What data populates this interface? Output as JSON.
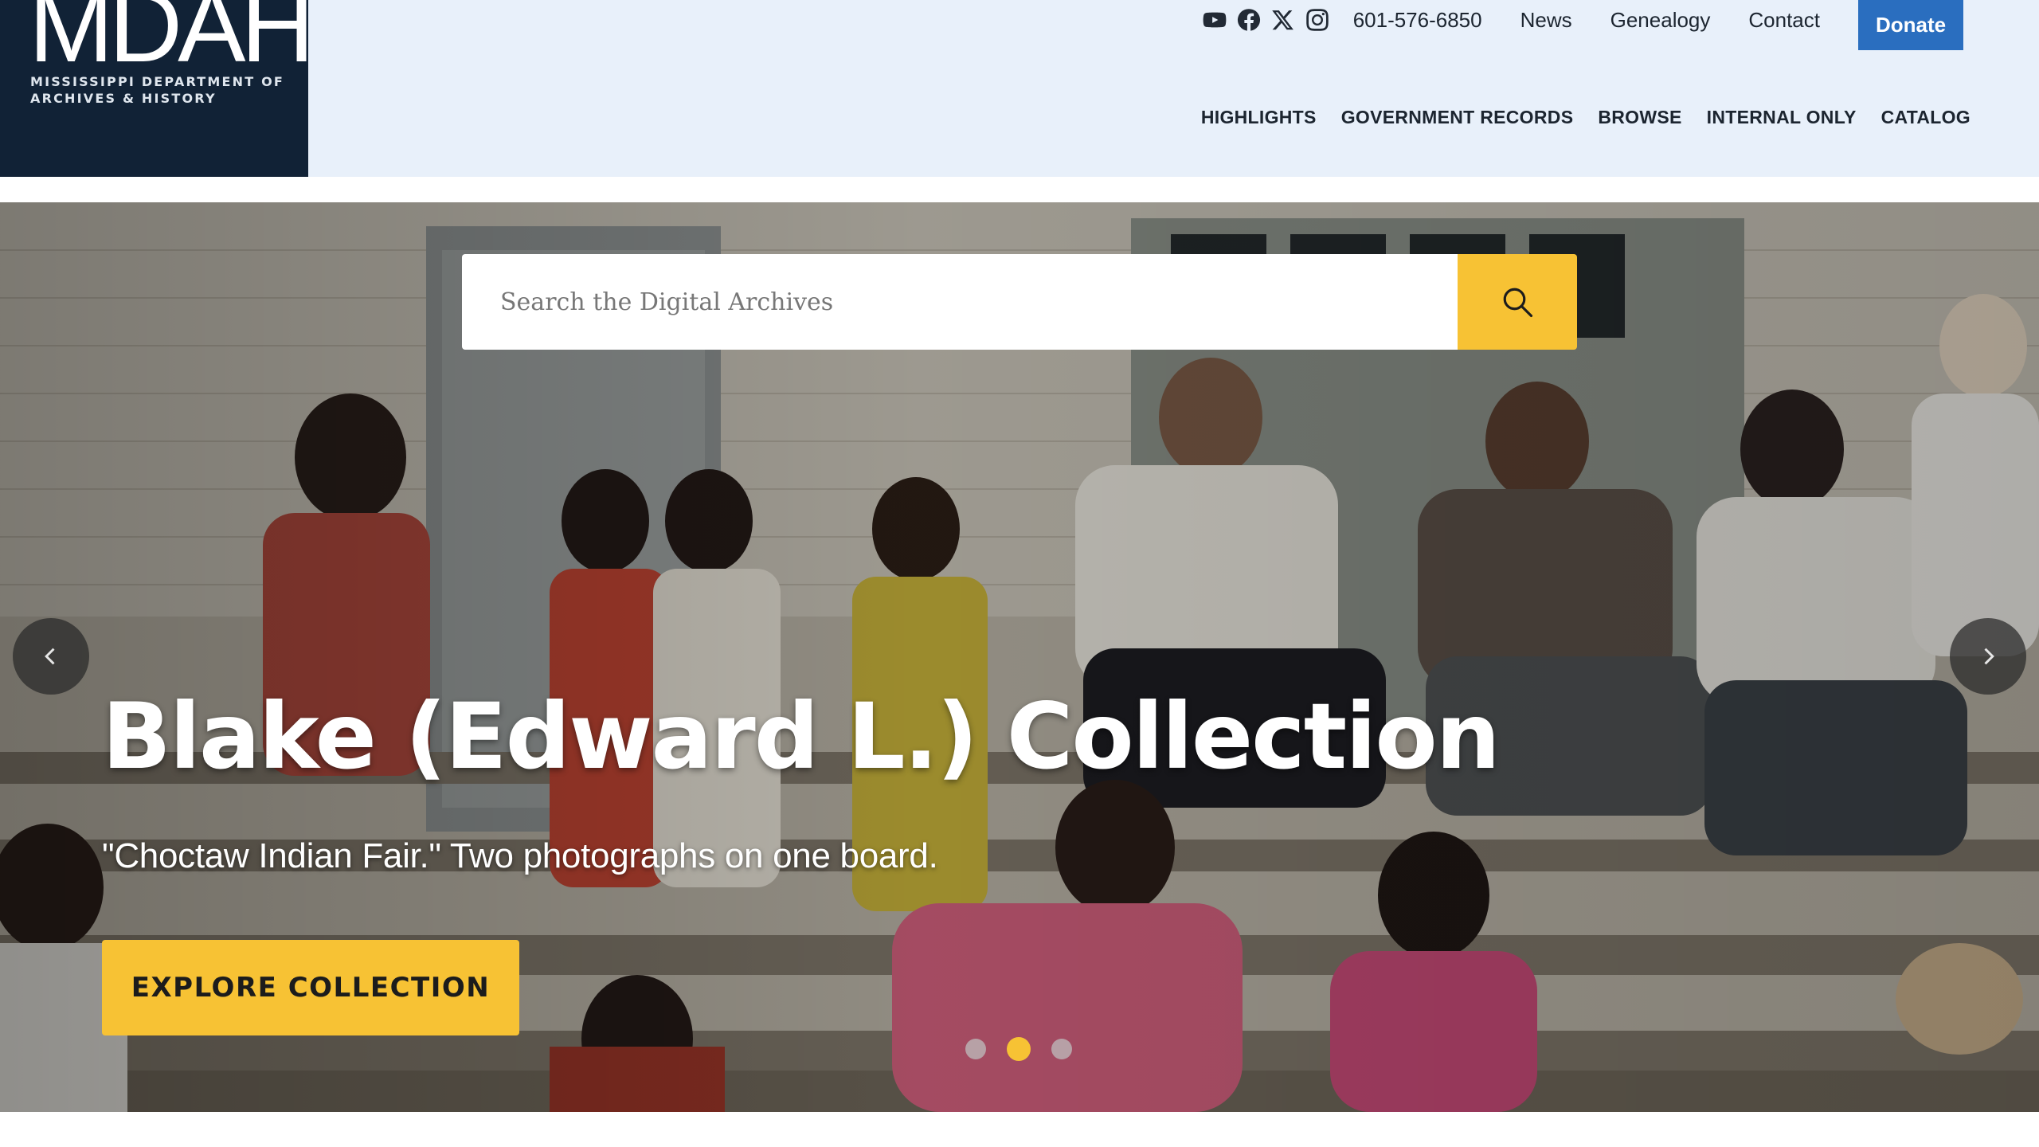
{
  "logo": {
    "mark": "MDAH",
    "line1": "Mississippi Department of",
    "line2": "Archives & History"
  },
  "utility": {
    "social_icons": [
      "youtube-icon",
      "facebook-icon",
      "x-icon",
      "instagram-icon"
    ],
    "phone": "601-576-6850",
    "links": [
      "News",
      "Genealogy",
      "Contact"
    ],
    "donate": "Donate"
  },
  "nav": {
    "items": [
      "HIGHLIGHTS",
      "GOVERNMENT RECORDS",
      "BROWSE",
      "INTERNAL ONLY",
      "CATALOG"
    ]
  },
  "search": {
    "placeholder": "Search the Digital Archives",
    "button_icon": "search-icon"
  },
  "hero": {
    "title": "Blake (Edward L.) Collection",
    "caption": "\"Choctaw Indian Fair.\" Two photographs on one board.",
    "cta": "EXPLORE COLLECTION",
    "slide_count": 3,
    "active_slide": 2
  },
  "colors": {
    "header_bg": "#e8f0fa",
    "logo_bg": "#112236",
    "accent": "#f7c234",
    "donate": "#2a6ebf"
  }
}
